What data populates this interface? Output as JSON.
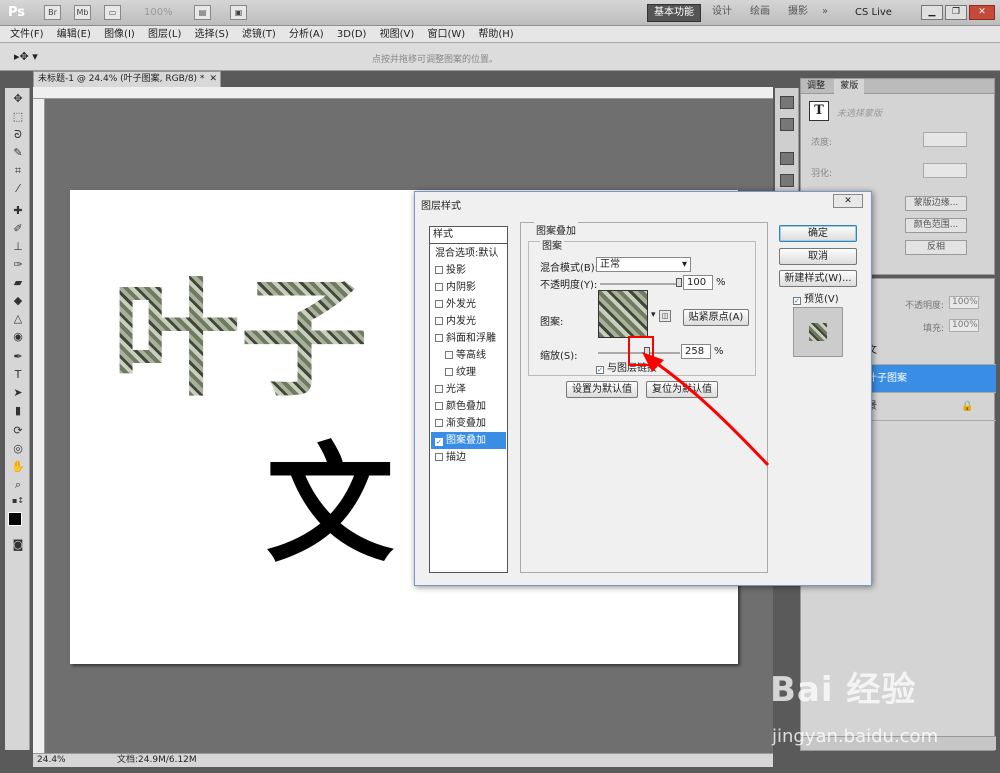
{
  "app": {
    "logo": "Ps",
    "zoom_dim": "100%",
    "workspaces": [
      "基本功能",
      "设计",
      "绘画",
      "摄影"
    ],
    "more": "»",
    "cs_live": "CS Live"
  },
  "menu": [
    "文件(F)",
    "编辑(E)",
    "图像(I)",
    "图层(L)",
    "选择(S)",
    "滤镜(T)",
    "分析(A)",
    "3D(D)",
    "视图(V)",
    "窗口(W)",
    "帮助(H)"
  ],
  "options": {
    "hint": "点按并拖移可调整图案的位置。"
  },
  "document": {
    "tab_title": "未标题-1 @ 24.4% (叶子图案, RGB/8) *",
    "text_pattern": "叶子",
    "text_black": "文",
    "status_zoom": "24.4%",
    "status_doc": "文档:24.9M/6.12M"
  },
  "panels": {
    "tabs": [
      "调整",
      "蒙版"
    ],
    "mask_label": "未选择蒙版",
    "density_label": "浓度:",
    "feather_label": "羽化:",
    "buttons": [
      "蒙版边缘...",
      "颜色范围...",
      "反相"
    ],
    "layers": {
      "opacity_label": "不透明度:",
      "opacity_value": "100%",
      "fill_label": "填充:",
      "fill_value": "100%",
      "row_text": "文",
      "selected_row": "叶子图案",
      "background_glyph": "景"
    }
  },
  "dialog": {
    "title": "图层样式",
    "close": "✕",
    "style_header": "样式",
    "styles": [
      {
        "label": "混合选项:默认",
        "checkbox": false,
        "checked": false,
        "sub": false
      },
      {
        "label": "投影",
        "checkbox": true,
        "checked": false,
        "sub": false
      },
      {
        "label": "内阴影",
        "checkbox": true,
        "checked": false,
        "sub": false
      },
      {
        "label": "外发光",
        "checkbox": true,
        "checked": false,
        "sub": false
      },
      {
        "label": "内发光",
        "checkbox": true,
        "checked": false,
        "sub": false
      },
      {
        "label": "斜面和浮雕",
        "checkbox": true,
        "checked": false,
        "sub": false
      },
      {
        "label": "等高线",
        "checkbox": true,
        "checked": false,
        "sub": true
      },
      {
        "label": "纹理",
        "checkbox": true,
        "checked": false,
        "sub": true
      },
      {
        "label": "光泽",
        "checkbox": true,
        "checked": false,
        "sub": false
      },
      {
        "label": "颜色叠加",
        "checkbox": true,
        "checked": false,
        "sub": false
      },
      {
        "label": "渐变叠加",
        "checkbox": true,
        "checked": false,
        "sub": false
      },
      {
        "label": "图案叠加",
        "checkbox": true,
        "checked": true,
        "sub": false
      },
      {
        "label": "描边",
        "checkbox": true,
        "checked": false,
        "sub": false
      }
    ],
    "section_title": "图案叠加",
    "group_title": "图案",
    "blend_mode_label": "混合模式(B):",
    "blend_mode_value": "正常",
    "opacity_label": "不透明度(Y):",
    "opacity_value": "100",
    "opacity_fraction": 1.0,
    "pct": "%",
    "pattern_label": "图案:",
    "snap_origin": "贴紧原点(A)",
    "scale_label": "缩放(S):",
    "scale_value": "258",
    "scale_fraction": 0.258,
    "link_label": "与图层链接",
    "set_default": "设置为默认值",
    "reset_default": "复位为默认值",
    "ok": "确定",
    "cancel": "取消",
    "new_style": "新建样式(W)...",
    "preview": "预览(V)"
  },
  "watermark": {
    "logo": "Bai 经验",
    "sub": "jingyan.baidu.com"
  },
  "colors": {
    "selection": "#3a8de4",
    "annotation": "#ff0000"
  }
}
